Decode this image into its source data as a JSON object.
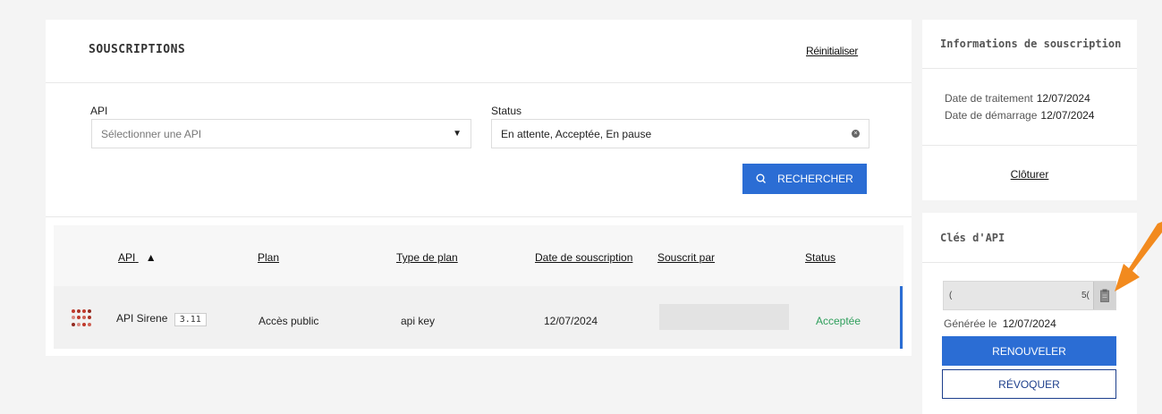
{
  "subscriptions": {
    "title": "SOUSCRIPTIONS",
    "reset_label": "Réinitialiser",
    "filters": {
      "api_label": "API",
      "api_placeholder": "Sélectionner une API",
      "status_label": "Status",
      "status_value": "En attente, Acceptée, En pause"
    },
    "search_label": "RECHERCHER",
    "table": {
      "headers": [
        "API",
        "Plan",
        "Type de plan",
        "Date de souscription",
        "Souscrit par",
        "Status"
      ],
      "sort_indicator": "▲",
      "rows": [
        {
          "api_name": "API Sirene",
          "version": "3.11",
          "plan": "Accès public",
          "plan_type": "api key",
          "date": "12/07/2024",
          "subscribed_by": "",
          "status": "Acceptée"
        }
      ]
    }
  },
  "subscription_info": {
    "title": "Informations de souscription",
    "processing_date_label": "Date de traitement",
    "processing_date": "12/07/2024",
    "start_date_label": "Date de démarrage",
    "start_date": "12/07/2024",
    "close_label": "Clôturer"
  },
  "api_keys": {
    "title": "Clés d'API",
    "key_start": "(",
    "key_end": "5(",
    "generated_label": "Générée le",
    "generated_date": "12/07/2024",
    "renew_label": "RENOUVELER",
    "revoke_label": "RÉVOQUER"
  },
  "colors": {
    "primary": "#2b6dd4",
    "accent_arrow": "#f28a1e",
    "status_accepted": "#2e9e5b"
  }
}
